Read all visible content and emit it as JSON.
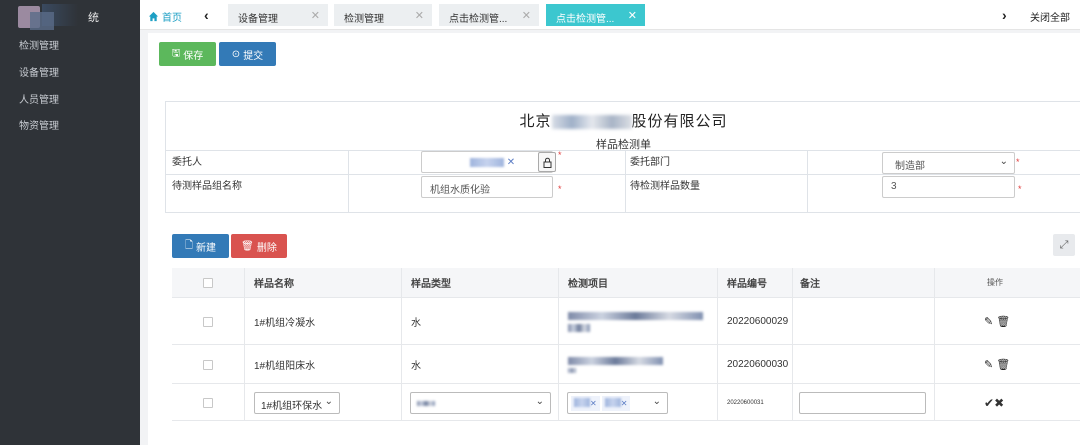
{
  "sidebar": {
    "title": "统",
    "items": [
      {
        "label": "检测管理"
      },
      {
        "label": "设备管理"
      },
      {
        "label": "人员管理"
      },
      {
        "label": "物资管理"
      }
    ]
  },
  "tabs": {
    "home": "首页",
    "items": [
      {
        "label": "设备管理"
      },
      {
        "label": "检测管理"
      },
      {
        "label": "点击检测管..."
      },
      {
        "label": "点击检测管..."
      }
    ],
    "close_all": "关闭全部"
  },
  "toolbar": {
    "save": "保存",
    "submit": "提交"
  },
  "form": {
    "company_prefix": "北京",
    "company_suffix": "股份有限公司",
    "subtitle": "样品检测单",
    "client_label": "委托人",
    "dept_label": "委托部门",
    "dept_value": "制造部",
    "group_label": "待测样品组名称",
    "group_value": "机组水质化验",
    "qty_label": "待检测样品数量",
    "qty_value": "3"
  },
  "actions": {
    "new": "新建",
    "delete": "删除"
  },
  "table": {
    "headers": [
      "样品名称",
      "样品类型",
      "检测项目",
      "样品编号",
      "备注",
      "操作"
    ],
    "rows": [
      {
        "name": "1#机组冷凝水",
        "type": "水",
        "code": "20220600029"
      },
      {
        "name": "1#机组阳床水",
        "type": "水",
        "code": "20220600030"
      }
    ],
    "edit_row": {
      "name": "1#机组环保水",
      "code": "20220600031"
    }
  },
  "colors": {
    "sidebar": "#2f3338",
    "active_tab": "#3cc7cf",
    "save_btn": "#5cb85c",
    "submit_btn": "#337ab7",
    "delete_btn": "#d9534f"
  }
}
